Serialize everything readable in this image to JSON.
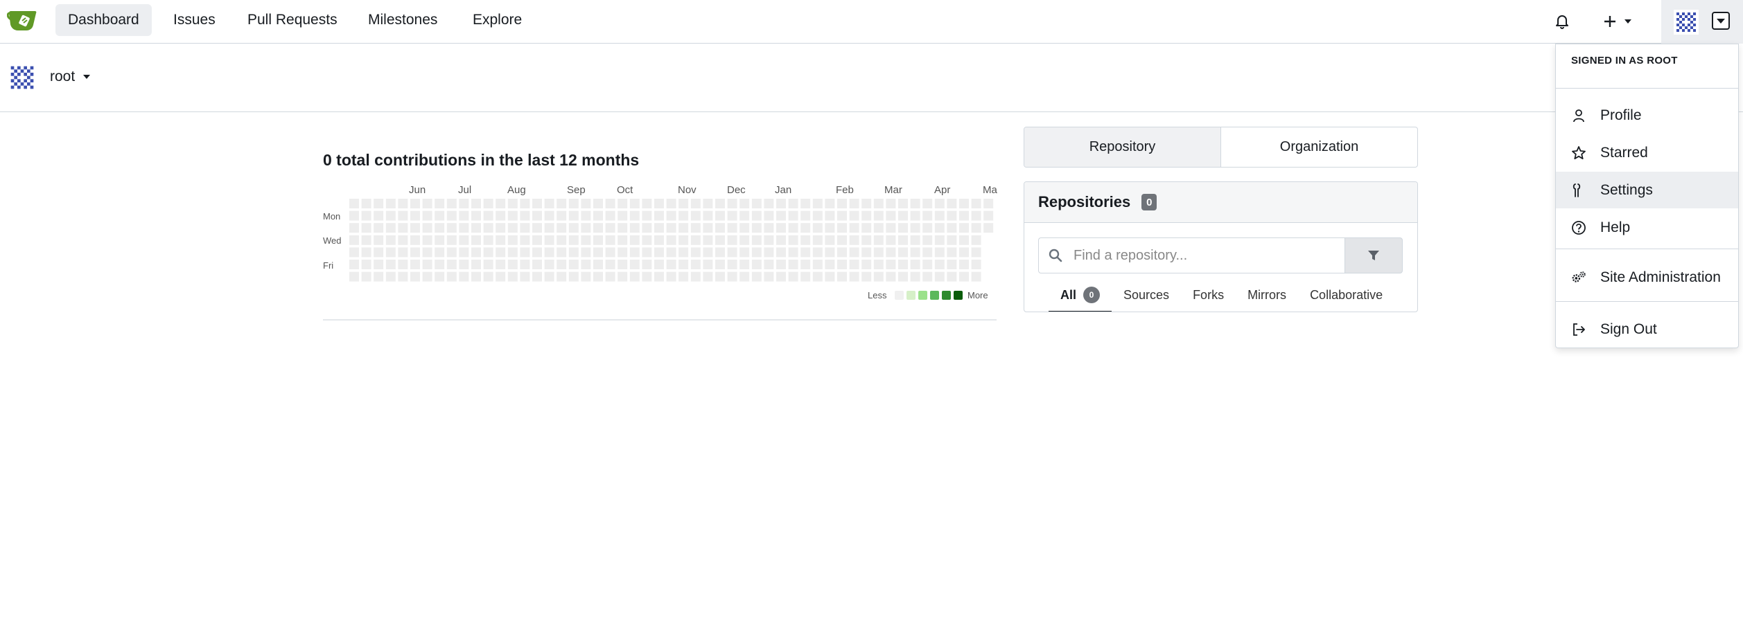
{
  "nav": {
    "items": [
      {
        "label": "Dashboard",
        "active": true
      },
      {
        "label": "Issues"
      },
      {
        "label": "Pull Requests"
      },
      {
        "label": "Milestones"
      },
      {
        "label": "Explore"
      }
    ],
    "icons": [
      "bell-icon",
      "plus-icon",
      "avatar",
      "chevron-down-icon"
    ]
  },
  "user": {
    "name": "root"
  },
  "heatmap": {
    "title": "0 total contributions in the last 12 months",
    "months": [
      "Jun",
      "Jul",
      "Aug",
      "Sep",
      "Oct",
      "Nov",
      "Dec",
      "Jan",
      "Feb",
      "Mar",
      "Apr",
      "Ma"
    ],
    "days": [
      "Mon",
      "Wed",
      "Fri"
    ],
    "legend_less": "Less",
    "legend_more": "More",
    "legend_colors": [
      "#f0f0f0",
      "#d6f0c8",
      "#9be18b",
      "#5cb85c",
      "#2e8b2e",
      "#0b5c0b"
    ],
    "empty_color": "#ededed"
  },
  "repo_panel": {
    "tab_repository": "Repository",
    "tab_organization": "Organization",
    "title": "Repositories",
    "count": "0",
    "search_placeholder": "Find a repository...",
    "subtabs": [
      {
        "label": "All",
        "count": "0",
        "active": true
      },
      {
        "label": "Sources"
      },
      {
        "label": "Forks"
      },
      {
        "label": "Mirrors"
      },
      {
        "label": "Collaborative"
      }
    ]
  },
  "dropdown": {
    "signed_in_as": "Signed in as",
    "username": "root",
    "items": {
      "profile": "Profile",
      "starred": "Starred",
      "settings": "Settings",
      "help": "Help",
      "site_admin": "Site Administration",
      "sign_out": "Sign Out"
    }
  }
}
